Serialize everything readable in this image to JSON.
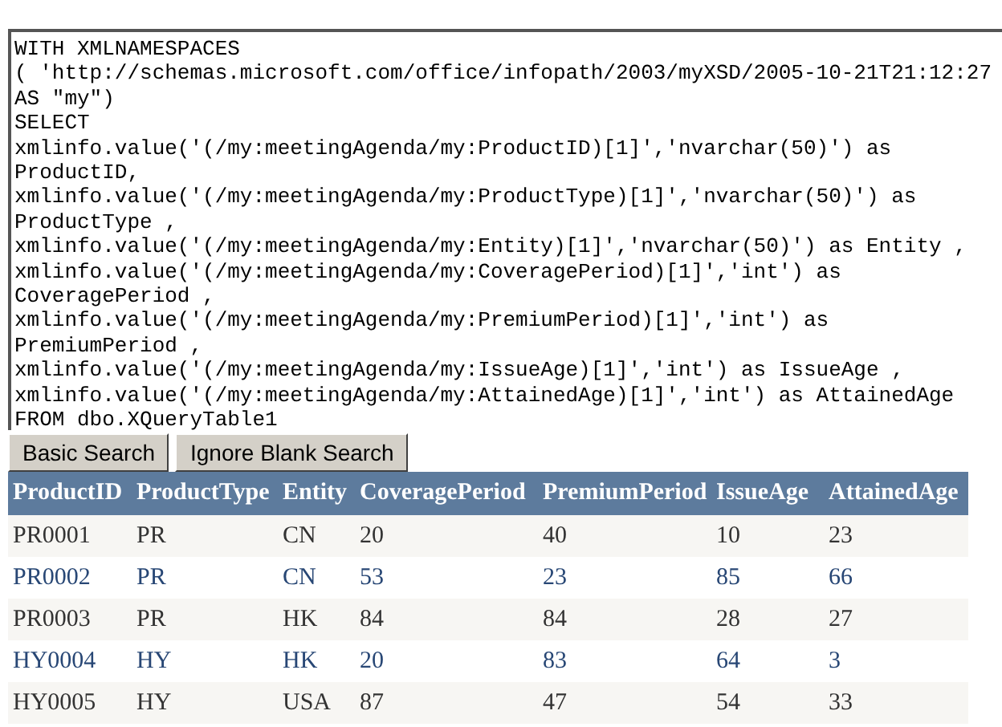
{
  "query_lines": [
    "WITH XMLNAMESPACES",
    "( 'http://schemas.microsoft.com/office/infopath/2003/myXSD/2005-10-21T21:12:27",
    "AS \"my\")",
    "SELECT",
    "xmlinfo.value('(/my:meetingAgenda/my:ProductID)[1]','nvarchar(50)') as",
    "ProductID,",
    "xmlinfo.value('(/my:meetingAgenda/my:ProductType)[1]','nvarchar(50)') as",
    "ProductType ,",
    "xmlinfo.value('(/my:meetingAgenda/my:Entity)[1]','nvarchar(50)') as Entity ,",
    "xmlinfo.value('(/my:meetingAgenda/my:CoveragePeriod)[1]','int') as",
    "CoveragePeriod ,",
    "xmlinfo.value('(/my:meetingAgenda/my:PremiumPeriod)[1]','int') as",
    "PremiumPeriod ,",
    "xmlinfo.value('(/my:meetingAgenda/my:IssueAge)[1]','int') as IssueAge ,",
    "xmlinfo.value('(/my:meetingAgenda/my:AttainedAge)[1]','int') as AttainedAge",
    "FROM dbo.XQueryTable1"
  ],
  "buttons": [
    "Basic Search",
    "Ignore Blank Search"
  ],
  "table": {
    "columns": [
      "ProductID",
      "ProductType",
      "Entity",
      "CoveragePeriod",
      "PremiumPeriod",
      "IssueAge",
      "AttainedAge"
    ],
    "rows": [
      [
        "PR0001",
        "PR",
        "CN",
        "20",
        "40",
        "10",
        "23"
      ],
      [
        "PR0002",
        "PR",
        "CN",
        "53",
        "23",
        "85",
        "66"
      ],
      [
        "PR0003",
        "PR",
        "HK",
        "84",
        "84",
        "28",
        "27"
      ],
      [
        "HY0004",
        "HY",
        "HK",
        "20",
        "83",
        "64",
        "3"
      ],
      [
        "HY0005",
        "HY",
        "USA",
        "87",
        "47",
        "54",
        "33"
      ]
    ]
  }
}
